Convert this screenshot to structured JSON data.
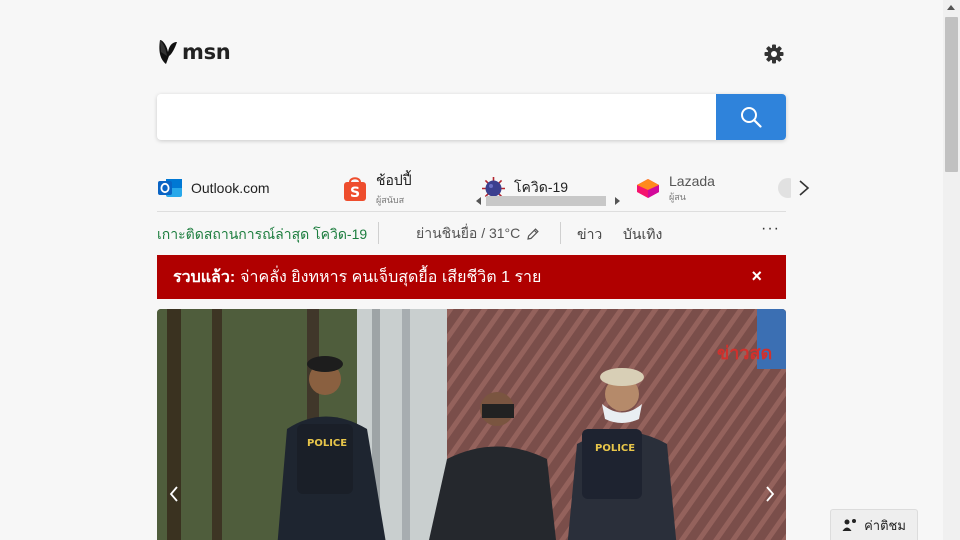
{
  "brand": {
    "name": "msn"
  },
  "search": {
    "placeholder": "",
    "value": ""
  },
  "quicklinks": [
    {
      "label": "Outlook.com",
      "sub": "",
      "icon": "outlook-icon",
      "color": "#0a64c4"
    },
    {
      "label": "ช้อปปี้",
      "sub": "ผู้สนับส",
      "icon": "shopee-icon",
      "color": "#ee4d2d"
    },
    {
      "label": "โควิด-19",
      "sub": "",
      "icon": "covid-icon",
      "color": "#3b3f8f"
    },
    {
      "label": "Lazada",
      "sub": "ผู้สน",
      "icon": "lazada-icon",
      "color": "#f5136e"
    }
  ],
  "nav": {
    "trending": "เกาะติดสถานการณ์ล่าสุด โควิด-19",
    "weather": "ย่านชินยื่อ / 31°C",
    "news": "ข่าว",
    "entertainment": "บันเทิง",
    "more": "···"
  },
  "breaking": {
    "tag": "รวบแล้ว:",
    "text": "จ่าคลั่ง ยิงทหาร คนเจ็บสุดยื้อ เสียชีวิต 1 ราย",
    "close": "×"
  },
  "hero": {
    "watermark": "ข่าวสด"
  },
  "feedback": {
    "label": "ค่าติชม"
  },
  "colors": {
    "accent": "#2f83db",
    "breaking": "#b00000",
    "trending": "#1c7d3e"
  }
}
